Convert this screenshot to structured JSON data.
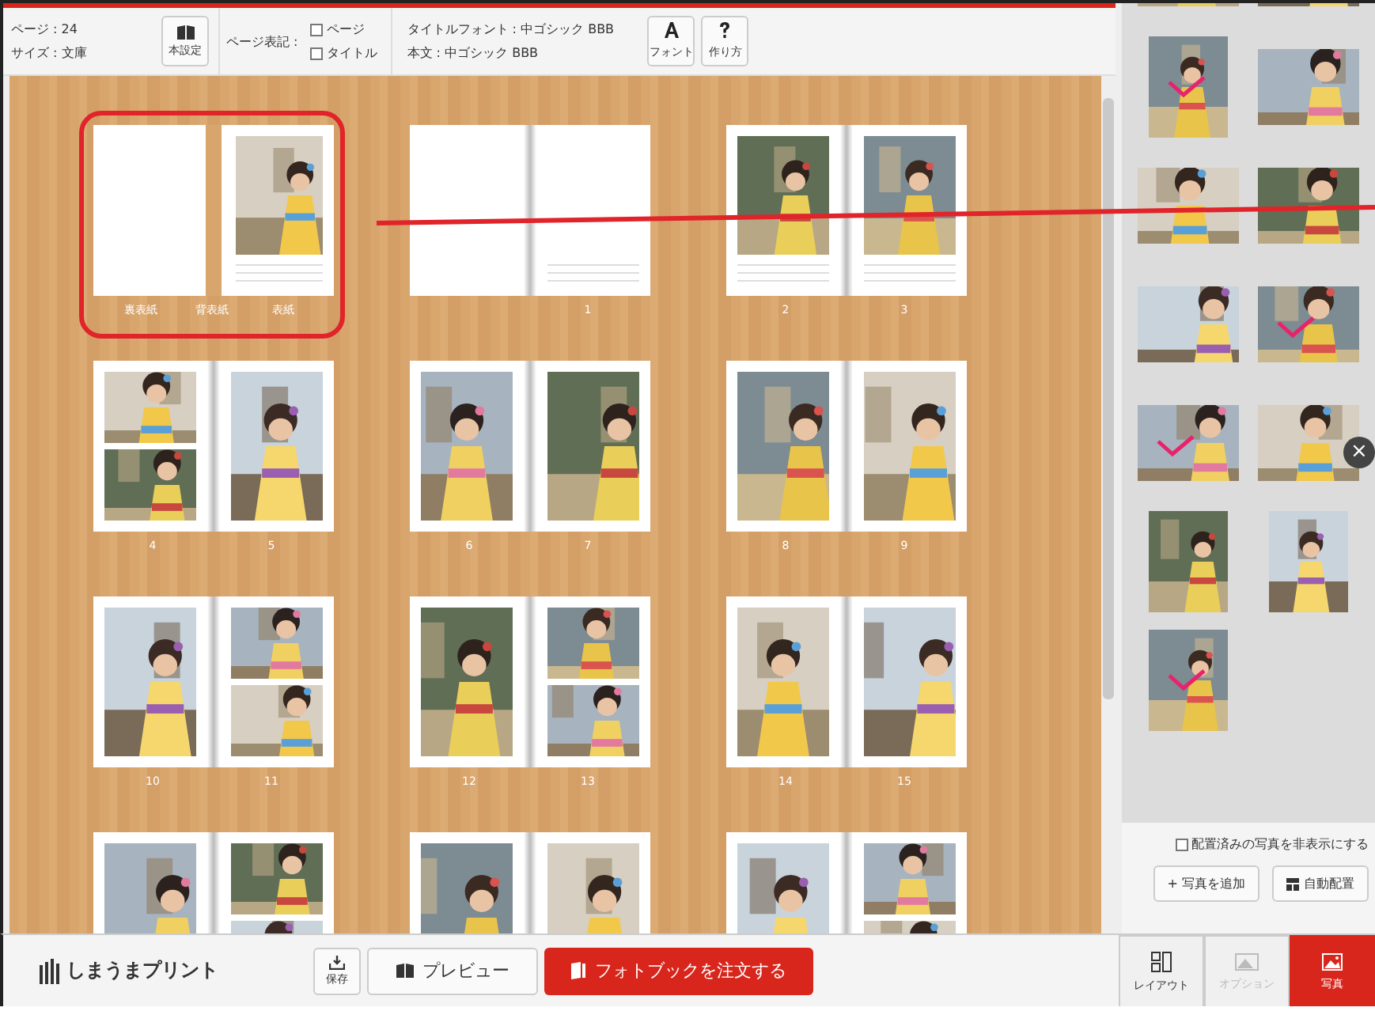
{
  "toolbar": {
    "info": [
      "ページ : 24",
      "サイズ : 文庫"
    ],
    "settings_button": "本設定",
    "page_notation": {
      "label": "ページ表記 :",
      "options": [
        {
          "label": "ページ",
          "checked": false
        },
        {
          "label": "タイトル",
          "checked": false
        }
      ]
    },
    "fonts": [
      "タイトルフォント : 中ゴシック BBB",
      "本文 : 中ゴシック BBB"
    ],
    "buttons": [
      "フォント",
      "作り方"
    ]
  },
  "spreads": [
    {
      "selected": true,
      "spine_label": "背表紙",
      "pages": [
        {
          "kind": "blank",
          "label": "裏表紙"
        },
        {
          "kind": "captioned",
          "label": "表紙"
        }
      ]
    },
    {
      "selected": false,
      "pages": [
        {
          "kind": "blank"
        },
        {
          "kind": "lined",
          "label": "1"
        }
      ]
    },
    {
      "selected": false,
      "pages": [
        {
          "kind": "captioned",
          "label": "2"
        },
        {
          "kind": "captioned",
          "label": "3"
        }
      ]
    },
    {
      "selected": false,
      "pages": [
        {
          "kind": "double",
          "label": "4"
        },
        {
          "kind": "single",
          "label": "5"
        }
      ]
    },
    {
      "selected": false,
      "pages": [
        {
          "kind": "single",
          "label": "6"
        },
        {
          "kind": "single",
          "label": "7"
        }
      ]
    },
    {
      "selected": false,
      "pages": [
        {
          "kind": "single",
          "label": "8"
        },
        {
          "kind": "single",
          "label": "9"
        }
      ]
    },
    {
      "selected": false,
      "pages": [
        {
          "kind": "single",
          "label": "10"
        },
        {
          "kind": "double",
          "label": "11"
        }
      ]
    },
    {
      "selected": false,
      "pages": [
        {
          "kind": "single",
          "label": "12"
        },
        {
          "kind": "double",
          "label": "13"
        }
      ]
    },
    {
      "selected": false,
      "pages": [
        {
          "kind": "single",
          "label": "14"
        },
        {
          "kind": "single",
          "label": "15"
        }
      ]
    },
    {
      "selected": false,
      "pages": [
        {
          "kind": "single"
        },
        {
          "kind": "double"
        }
      ]
    },
    {
      "selected": false,
      "pages": [
        {
          "kind": "single"
        },
        {
          "kind": "single"
        }
      ]
    },
    {
      "selected": false,
      "pages": [
        {
          "kind": "single"
        },
        {
          "kind": "double"
        }
      ]
    }
  ],
  "gallery": {
    "photos": [
      {
        "kind": "landscape",
        "used": false
      },
      {
        "kind": "landscape",
        "used": false
      },
      {
        "kind": "portrait",
        "used": true
      },
      {
        "kind": "landscape",
        "used": false
      },
      {
        "kind": "landscape",
        "used": false
      },
      {
        "kind": "landscape",
        "used": false
      },
      {
        "kind": "landscape",
        "used": false
      },
      {
        "kind": "landscape",
        "used": true
      },
      {
        "kind": "landscape",
        "used": true
      },
      {
        "kind": "landscape",
        "used": false
      },
      {
        "kind": "portrait",
        "used": false
      },
      {
        "kind": "portrait",
        "used": false
      },
      {
        "kind": "portrait",
        "used": true
      }
    ],
    "close_button": "×",
    "hide_placed": {
      "label": "配置済みの写真を非表示にする",
      "checked": false
    },
    "buttons": [
      "+ 写真を追加",
      "自動配置"
    ]
  },
  "bottom_bar": {
    "logo": "しまうまプリント",
    "save_button": "保存",
    "preview_button": "プレビュー",
    "order_button": "フォトブックを注文する",
    "tabs": [
      {
        "label": "レイアウト",
        "selected": false,
        "disabled": false
      },
      {
        "label": "オプション",
        "selected": false,
        "disabled": true
      },
      {
        "label": "写真",
        "selected": true,
        "disabled": false
      }
    ]
  }
}
